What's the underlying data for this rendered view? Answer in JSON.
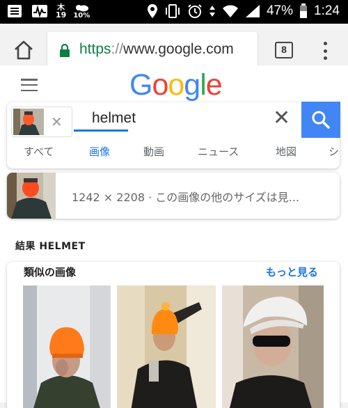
{
  "status_bar": {
    "day_label": "木",
    "date_number": "19",
    "weather_pct": "10%",
    "battery_pct": "47%",
    "time": "1:24"
  },
  "browser": {
    "url_scheme": "https",
    "url_sep": "://",
    "url_host": "www.google.com",
    "tab_count": "8"
  },
  "logo": {
    "letters": [
      "G",
      "o",
      "o",
      "g",
      "l",
      "e"
    ]
  },
  "search": {
    "query": "helmet",
    "tabs": [
      "すべて",
      "画像",
      "動画",
      "ニュース",
      "地図",
      "シ"
    ],
    "active_tab": "画像"
  },
  "image_info": {
    "text": "1242 × 2208 · この画像の他のサイズは見..."
  },
  "result": {
    "label": "結果 HELMET"
  },
  "similar": {
    "title": "類似の画像",
    "more": "もっと見る"
  },
  "colors": {
    "google_blue": "#4285f4",
    "link_blue": "#1a73e8",
    "https_green": "#0b8043",
    "orange_beanie": "#ff6d1f"
  }
}
